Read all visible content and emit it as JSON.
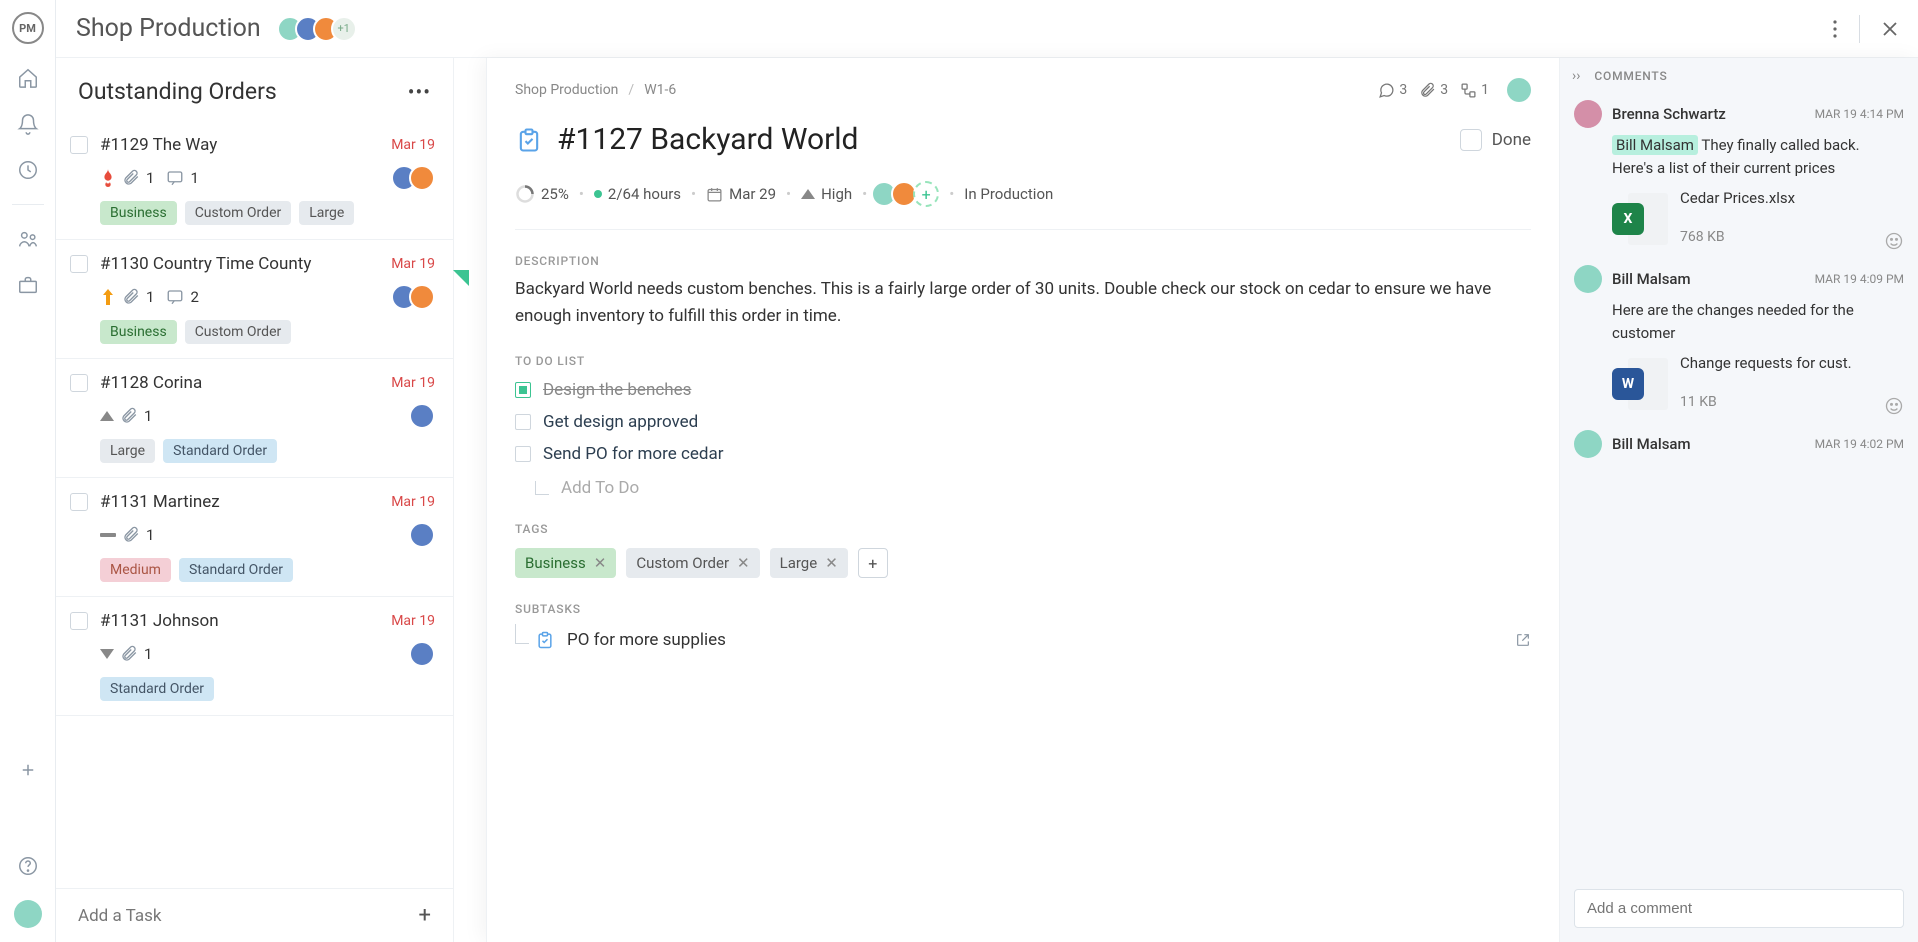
{
  "header": {
    "project_title": "Shop Production",
    "avatar_extra": "+1"
  },
  "column": {
    "title": "Outstanding Orders",
    "add_task_label": "Add a Task",
    "cards": [
      {
        "title": "#1129 The Way",
        "date": "Mar 19",
        "priority": "critical",
        "attachments": "1",
        "comments": "1",
        "assignees": 2,
        "tags": [
          {
            "label": "Business",
            "cls": "tag-green"
          },
          {
            "label": "Custom Order",
            "cls": "tag-grey"
          },
          {
            "label": "Large",
            "cls": "tag-grey"
          }
        ]
      },
      {
        "title": "#1130 Country Time County",
        "date": "Mar 19",
        "priority": "urgent",
        "attachments": "1",
        "comments": "2",
        "assignees": 2,
        "tags": [
          {
            "label": "Business",
            "cls": "tag-green"
          },
          {
            "label": "Custom Order",
            "cls": "tag-grey"
          }
        ]
      },
      {
        "title": "#1128 Corina",
        "date": "Mar 19",
        "priority": "high",
        "attachments": "1",
        "comments": null,
        "assignees": 1,
        "tags": [
          {
            "label": "Large",
            "cls": "tag-grey"
          },
          {
            "label": "Standard Order",
            "cls": "tag-blue"
          }
        ]
      },
      {
        "title": "#1131 Martinez",
        "date": "Mar 19",
        "priority": "none",
        "attachments": "1",
        "comments": null,
        "assignees": 1,
        "tags": [
          {
            "label": "Medium",
            "cls": "tag-pink"
          },
          {
            "label": "Standard Order",
            "cls": "tag-blue"
          }
        ]
      },
      {
        "title": "#1131 Johnson",
        "date": "Mar 19",
        "priority": "low",
        "attachments": "1",
        "comments": null,
        "assignees": 1,
        "tags": [
          {
            "label": "Standard Order",
            "cls": "tag-blue"
          }
        ]
      }
    ]
  },
  "detail": {
    "breadcrumb": {
      "project": "Shop Production",
      "column": "W1-6"
    },
    "counts": {
      "comments": "3",
      "attachments": "3",
      "subtasks": "1"
    },
    "title": "#1127 Backyard World",
    "done_label": "Done",
    "progress": "25%",
    "hours": "2/64 hours",
    "due": "Mar 29",
    "priority": "High",
    "status": "In Production",
    "section_labels": {
      "description": "DESCRIPTION",
      "todo": "TO DO LIST",
      "tags": "TAGS",
      "subtasks": "SUBTASKS"
    },
    "description": "Backyard World needs custom benches. This is a fairly large order of 30 units. Double check our stock on cedar to ensure we have enough inventory to fulfill this order in time.",
    "todos": [
      {
        "text": "Design the benches",
        "done": true
      },
      {
        "text": "Get design approved",
        "done": false
      },
      {
        "text": "Send PO for more cedar",
        "done": false
      }
    ],
    "add_todo_placeholder": "Add To Do",
    "tags": [
      {
        "label": "Business",
        "cls": "tag-green"
      },
      {
        "label": "Custom Order",
        "cls": "tag-grey"
      },
      {
        "label": "Large",
        "cls": "tag-grey"
      }
    ],
    "subtasks": [
      {
        "text": "PO for more supplies"
      }
    ]
  },
  "comments": {
    "title": "COMMENTS",
    "input_placeholder": "Add a comment",
    "items": [
      {
        "author": "Brenna Schwartz",
        "time": "MAR 19 4:14 PM",
        "mention": "Bill Malsam",
        "body": "They finally called back. Here's a list of their current prices",
        "file": {
          "name": "Cedar Prices.xlsx",
          "size": "768 KB",
          "kind": "x",
          "color": "#1e8449"
        }
      },
      {
        "author": "Bill Malsam",
        "time": "MAR 19 4:09 PM",
        "mention": null,
        "body": "Here are the changes needed for the customer",
        "file": {
          "name": "Change requests for cust.",
          "size": "11 KB",
          "kind": "w",
          "color": "#2a5699"
        }
      },
      {
        "author": "Bill Malsam",
        "time": "MAR 19 4:02 PM",
        "mention": null,
        "body": "",
        "file": null
      }
    ]
  },
  "avatar_colors": [
    "#8ed6c4",
    "#5a7fc4",
    "#f08a3c",
    "#d48fa8"
  ]
}
